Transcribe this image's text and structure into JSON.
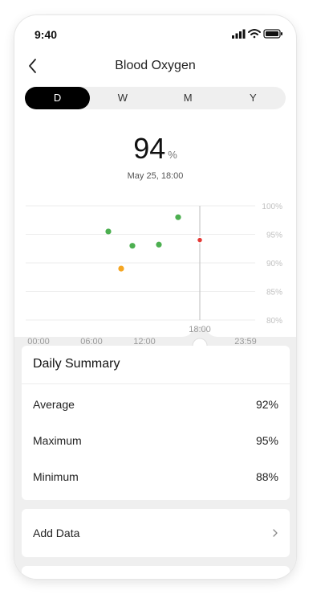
{
  "status": {
    "time": "9:40"
  },
  "nav": {
    "title": "Blood Oxygen"
  },
  "tabs": [
    {
      "label": "D",
      "active": true
    },
    {
      "label": "W",
      "active": false
    },
    {
      "label": "M",
      "active": false
    },
    {
      "label": "Y",
      "active": false
    }
  ],
  "reading": {
    "value": "94",
    "unit": "%",
    "timestamp": "May 25, 18:00"
  },
  "chart_data": {
    "type": "scatter",
    "x_ticks": [
      "00:00",
      "06:00",
      "12:00",
      "23:59"
    ],
    "y_ticks": [
      "100%",
      "95%",
      "90%",
      "85%",
      "80%"
    ],
    "ylim": [
      80,
      100
    ],
    "xlim": [
      0,
      24
    ],
    "cursor_label": "18:00",
    "cursor_x": 18,
    "points": [
      {
        "x": 15,
        "y": 98.0,
        "color": "#4caf50"
      },
      {
        "x": 7.2,
        "y": 95.5,
        "color": "#4caf50"
      },
      {
        "x": 10.5,
        "y": 93.0,
        "color": "#4caf50"
      },
      {
        "x": 14.2,
        "y": 93.2,
        "color": "#4caf50"
      },
      {
        "x": 9.1,
        "y": 89.0,
        "color": "#f5a623"
      },
      {
        "x": 18,
        "y": 94.0,
        "color": "#e53935"
      }
    ]
  },
  "summary": {
    "title": "Daily Summary",
    "rows": [
      {
        "label": "Average",
        "value": "92%"
      },
      {
        "label": "Maximum",
        "value": "95%"
      },
      {
        "label": "Minimum",
        "value": "88%"
      }
    ]
  },
  "add_data": {
    "label": "Add Data"
  },
  "colors": {
    "active_tab": "#000000",
    "normal": "#4caf50",
    "low": "#f5a623",
    "selected": "#e53935"
  }
}
